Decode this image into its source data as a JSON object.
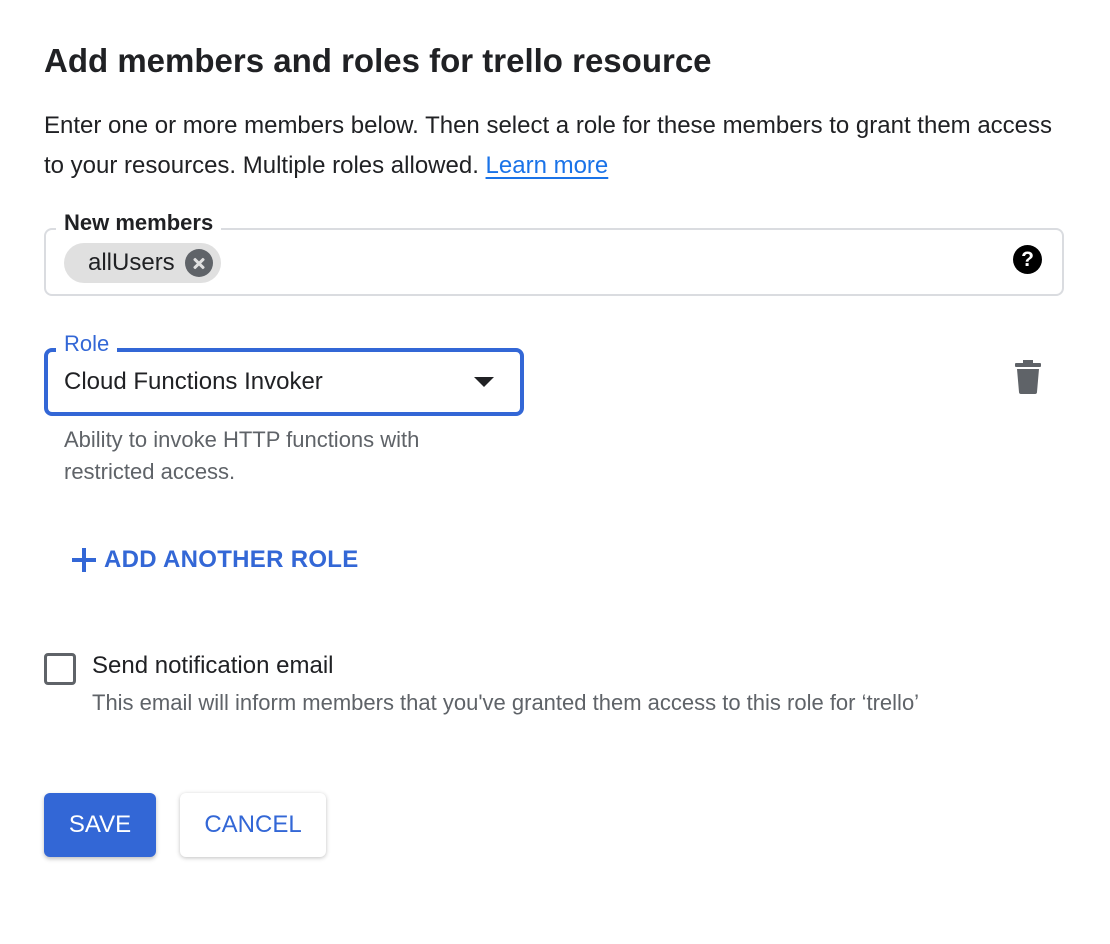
{
  "dialog": {
    "title": "Add members and roles for trello resource",
    "description": "Enter one or more members below. Then select a role for these members to grant them access to your resources. Multiple roles allowed.",
    "learn_more": "Learn more"
  },
  "members": {
    "label": "New members",
    "chips": [
      "allUsers"
    ],
    "help_icon": "help-circle-icon",
    "help_glyph": "?"
  },
  "role": {
    "label": "Role",
    "value": "Cloud Functions Invoker",
    "description": "Ability to invoke HTTP functions with restricted access.",
    "delete_icon": "trash-icon"
  },
  "add_role": {
    "label": "ADD ANOTHER ROLE",
    "icon": "plus-icon"
  },
  "notification": {
    "label": "Send notification email",
    "description": "This email will inform members that you've granted them access to this role for ‘trello’",
    "checked": false
  },
  "actions": {
    "save_label": "SAVE",
    "cancel_label": "CANCEL"
  },
  "colors": {
    "accent": "#3367d6",
    "link": "#1a73e8",
    "text": "#202124",
    "secondary_text": "#5f6368",
    "chip_bg": "#e0e0e0",
    "border": "#dadce0"
  }
}
